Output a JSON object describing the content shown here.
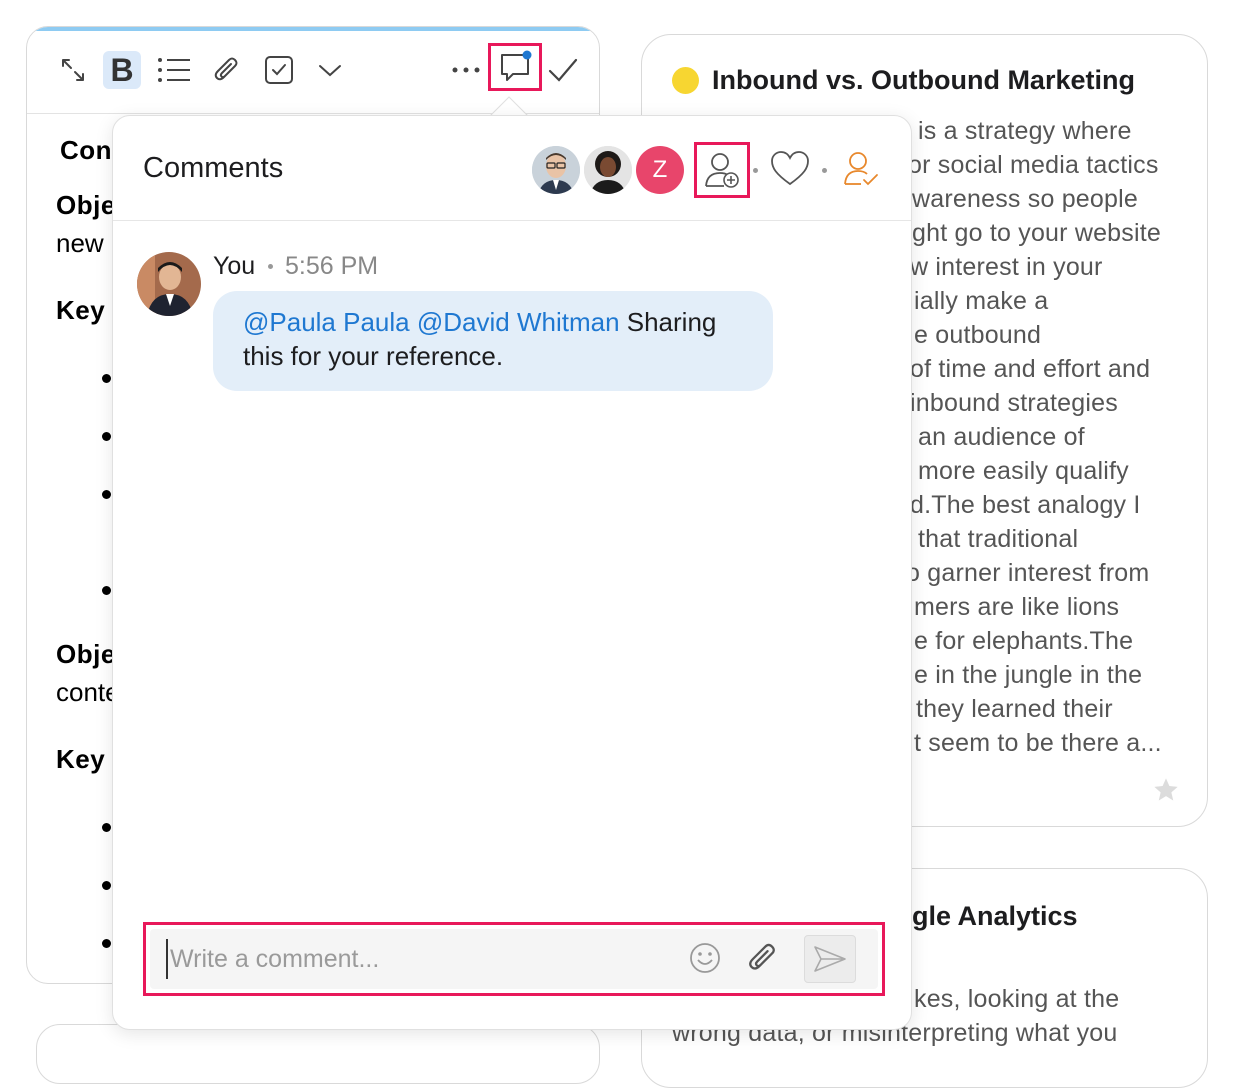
{
  "editor": {
    "toolbar": {
      "expand_icon": "expand-arrows-icon",
      "bold_label": "B",
      "list_icon": "bulleted-list-icon",
      "attach_icon": "paperclip-icon",
      "checkbox_icon": "checkbox-icon",
      "dropdown_icon": "chevron-down-icon",
      "more_icon": "ellipsis-icon",
      "comment_icon": "comment-bubble-icon",
      "done_icon": "checkmark-icon"
    },
    "visible_text": {
      "line1": "Con",
      "line2": "Obje",
      "line3": "new",
      "line4": "Key",
      "line5": "Obje",
      "line6": "conte",
      "line7": "Key"
    }
  },
  "right_cards": [
    {
      "title": "Inbound vs. Outbound Marketing",
      "dot_color": "#f7d631",
      "visible_lines": [
        "is a strategy where",
        "or social media tactics",
        "wareness so people",
        "ght go to your website",
        "w interest in your",
        "ially make a",
        "e outbound",
        "of time and effort and",
        "inbound strategies",
        "an audience of",
        "more easily qualify",
        "d.The best analogy I",
        "that traditional",
        "o garner interest from",
        "mers are like lions",
        "e for elephants.The",
        "e in the jungle in the",
        "they learned their",
        "t seem to be there a..."
      ],
      "star_icon": "star-icon"
    },
    {
      "title_fragment": "gle Analytics",
      "visible_lines": [
        "kes, looking at the",
        "wrong data, or misinterpreting what you"
      ]
    }
  ],
  "comments": {
    "title": "Comments",
    "participants": [
      {
        "name": "avatar-man-glasses",
        "type": "photo"
      },
      {
        "name": "avatar-woman",
        "type": "photo"
      },
      {
        "name": "avatar-z",
        "initial": "Z",
        "color": "#e8456b"
      }
    ],
    "header_icons": {
      "add_person": "add-person-icon",
      "heart": "heart-icon",
      "assign": "assign-person-icon"
    },
    "message": {
      "author": "You",
      "time": "5:56 PM",
      "mention1": "@Paula Paula",
      "mention2": "@David Whitman",
      "text": " Sharing this for your reference."
    },
    "input": {
      "placeholder": "Write a comment...",
      "emoji_icon": "emoji-icon",
      "attach_icon": "paperclip-icon",
      "send_icon": "send-icon"
    }
  },
  "colors": {
    "highlight": "#e8185a",
    "mention": "#1f78d1",
    "bubble": "#e3eef9",
    "accent_orange": "#e8882c"
  }
}
